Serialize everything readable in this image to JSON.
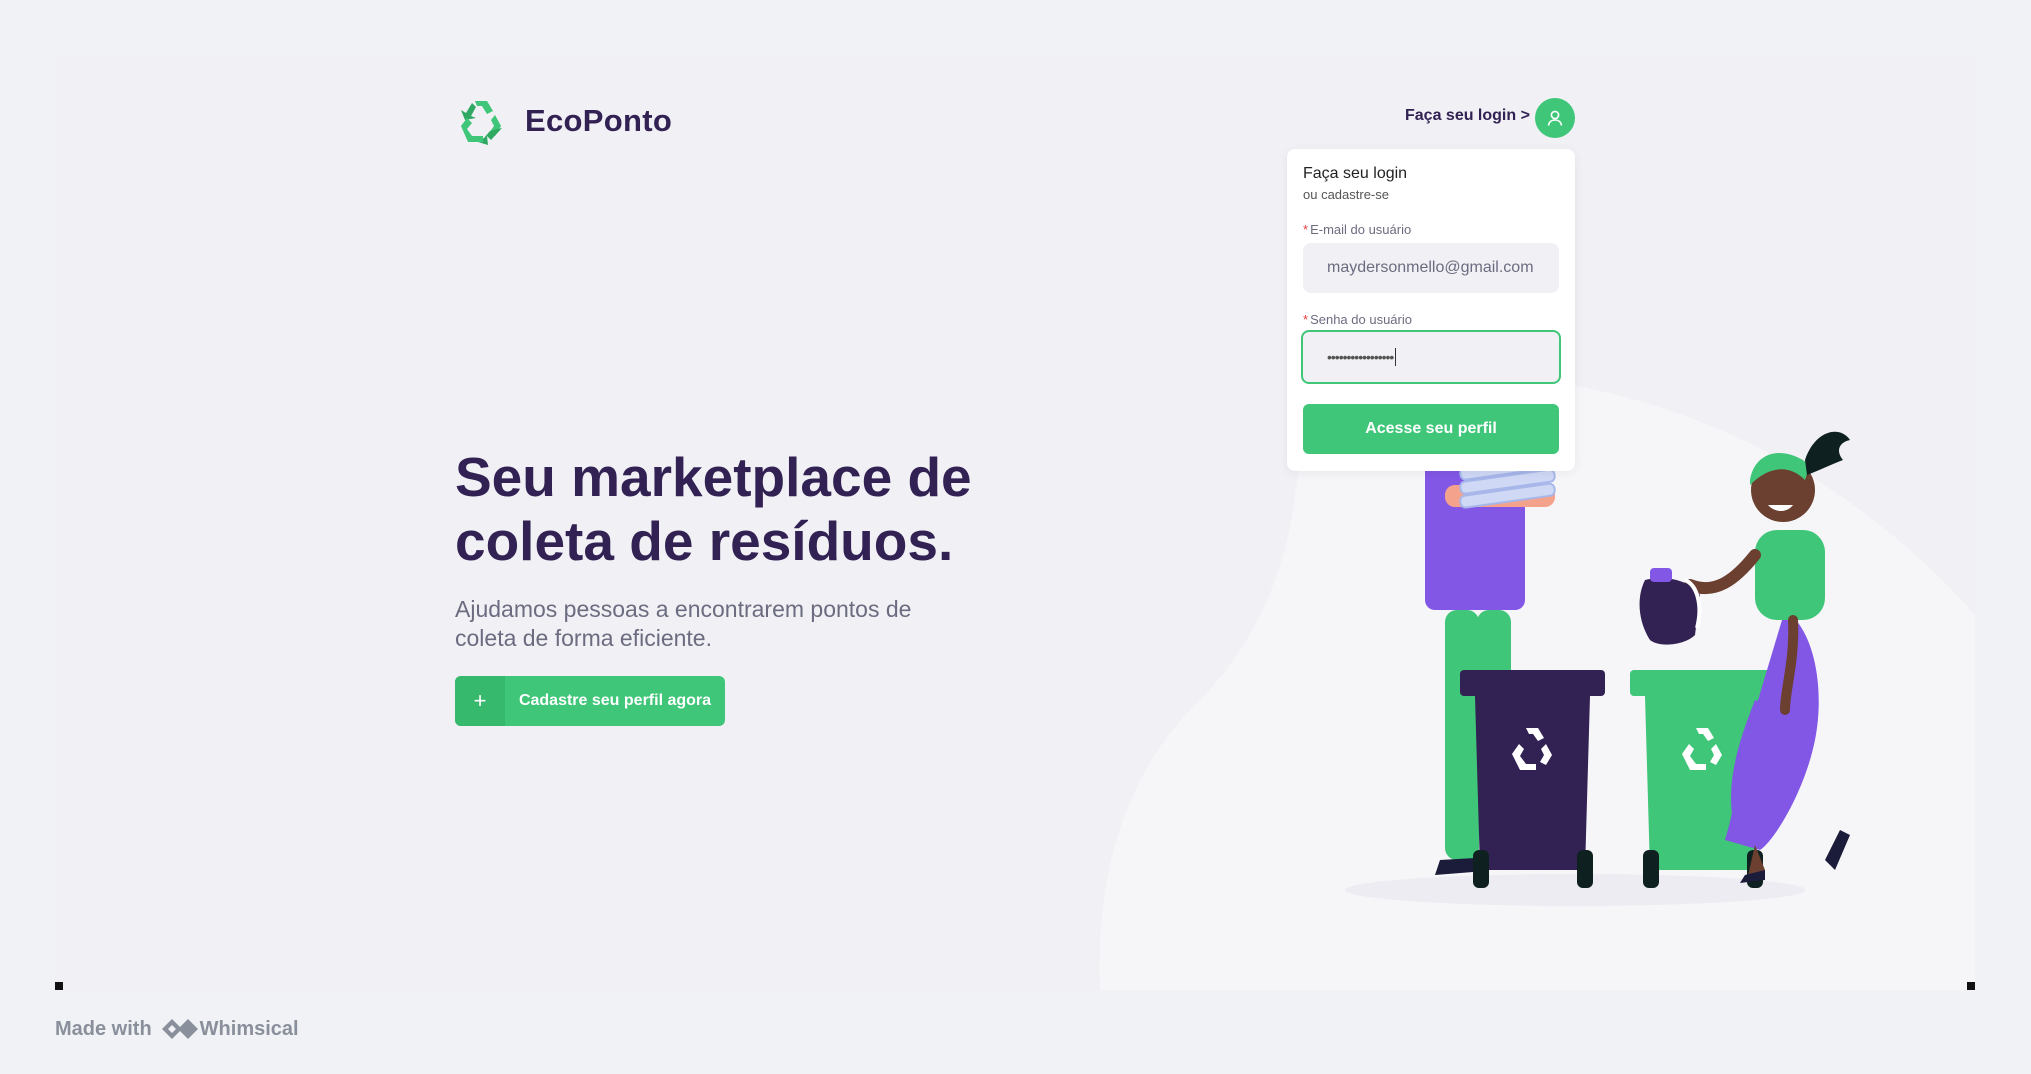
{
  "brand": {
    "name": "EcoPonto",
    "logo_icon": "recycle-icon"
  },
  "header": {
    "login_link": "Faça seu login >",
    "user_icon": "user-icon"
  },
  "hero": {
    "title": "Seu marketplace de coleta de resíduos.",
    "subtitle": "Ajudamos pessoas a encontrarem pontos de coleta de forma eficiente.",
    "cta_label": "Cadastre seu perfil agora",
    "cta_icon": "plus-icon"
  },
  "login_popover": {
    "title": "Faça seu login",
    "subtitle": "ou cadastre-se",
    "email_label": "E-mail do usuário",
    "email_value": "maydersonmello@gmail.com",
    "password_label": "Senha do usuário",
    "password_value": "•••••••••••••••••",
    "required_mark": "*",
    "submit_label": "Acesse seu perfil"
  },
  "footer": {
    "made_with": "Made with",
    "brand": "Whimsical"
  },
  "colors": {
    "primary": "#3fc678",
    "title": "#322153",
    "text": "#6c6c80",
    "background": "#f0f0f5"
  }
}
